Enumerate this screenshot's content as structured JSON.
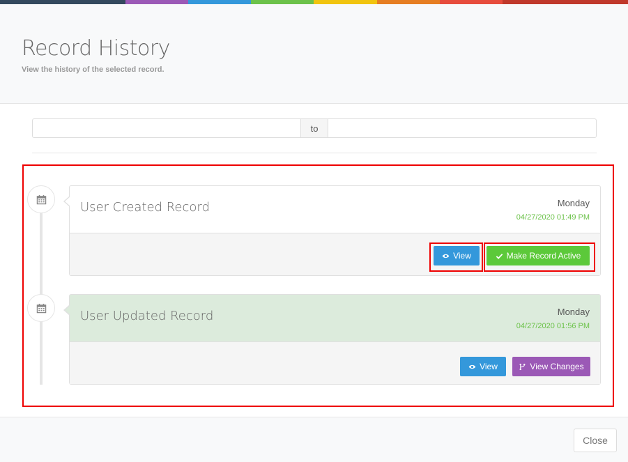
{
  "stripe_colors": [
    "#34495e",
    "#34495e",
    "#9b59b6",
    "#3498db",
    "#6cc24a",
    "#f1c40f",
    "#e67e22",
    "#e74c3c",
    "#c0392b",
    "#c0392b"
  ],
  "header": {
    "title": "Record History",
    "subtitle": "View the history of the selected record."
  },
  "range": {
    "separator": "to",
    "from_value": "",
    "to_value": ""
  },
  "timeline": [
    {
      "title": "User Created Record",
      "day": "Monday",
      "datetime": "04/27/2020 01:49 PM",
      "buttons": [
        {
          "label": "View",
          "icon": "eye-icon"
        },
        {
          "label": "Make Record Active",
          "icon": "check-icon"
        }
      ]
    },
    {
      "title": "User Updated Record",
      "day": "Monday",
      "datetime": "04/27/2020 01:56 PM",
      "buttons": [
        {
          "label": "View",
          "icon": "eye-icon"
        },
        {
          "label": "View Changes",
          "icon": "branch-icon"
        }
      ]
    }
  ],
  "footer": {
    "close_label": "Close"
  }
}
